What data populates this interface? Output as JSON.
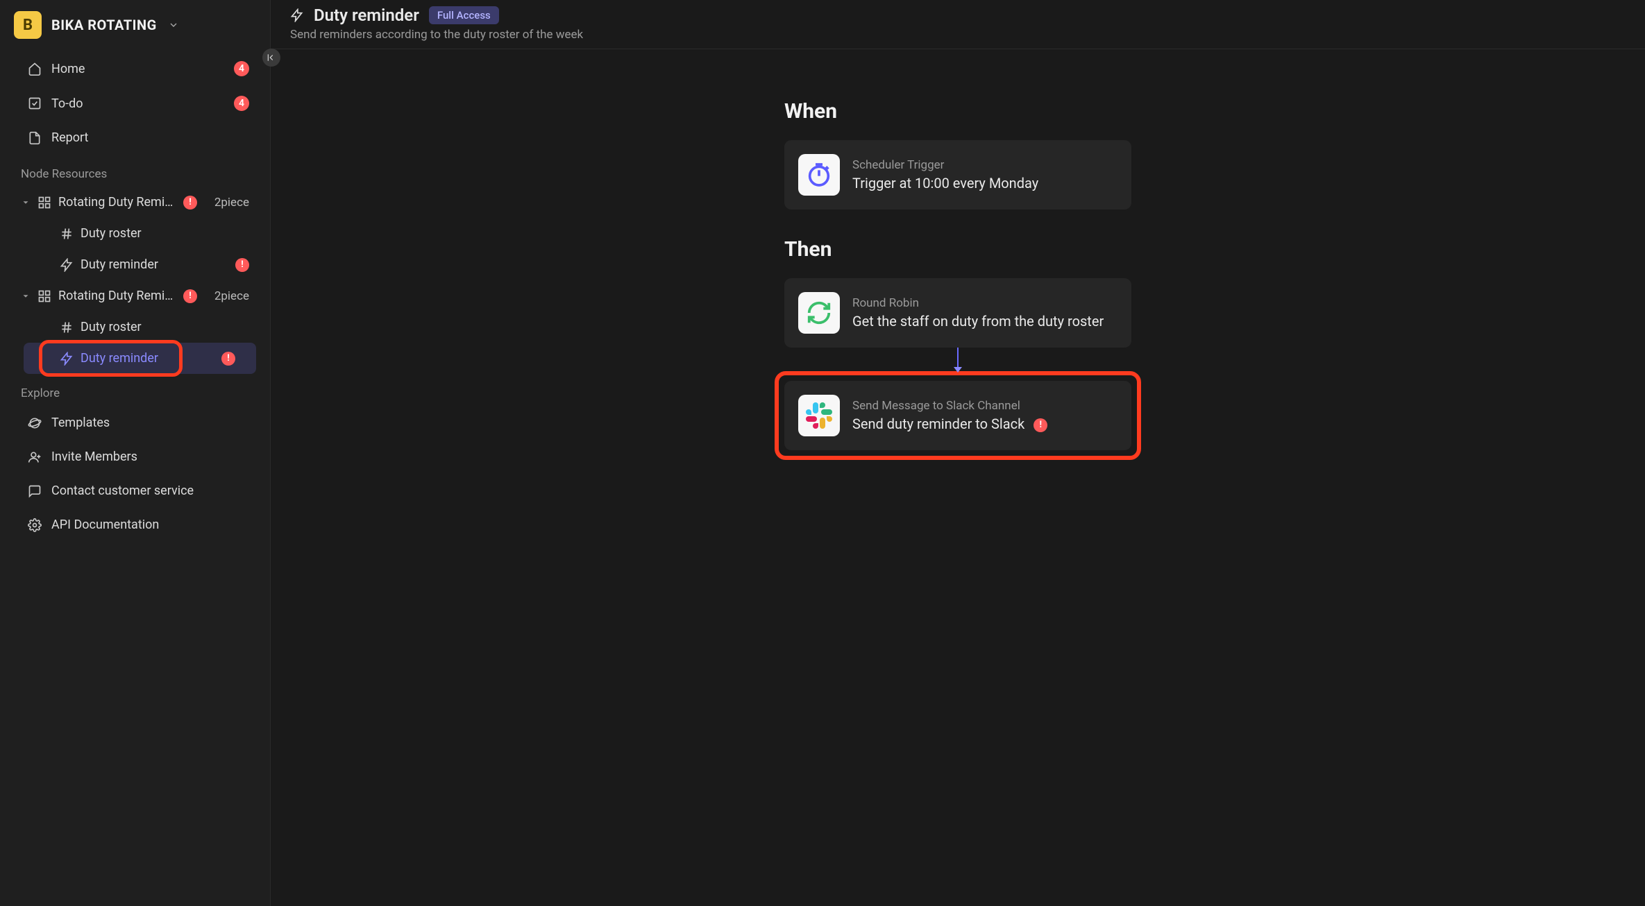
{
  "workspace": {
    "avatar_letter": "B",
    "name": "BIKA ROTATING"
  },
  "nav": {
    "home": {
      "label": "Home",
      "badge": "4"
    },
    "todo": {
      "label": "To-do",
      "badge": "4"
    },
    "report": {
      "label": "Report"
    }
  },
  "sections": {
    "resources_label": "Node Resources",
    "explore_label": "Explore"
  },
  "tree": {
    "group1": {
      "label": "Rotating Duty Remin…",
      "count": "2piece"
    },
    "group1_roster": {
      "label": "Duty roster"
    },
    "group1_reminder": {
      "label": "Duty reminder"
    },
    "group2": {
      "label": "Rotating Duty Remin…",
      "count": "2piece"
    },
    "group2_roster": {
      "label": "Duty roster"
    },
    "group2_reminder": {
      "label": "Duty reminder"
    }
  },
  "explore": {
    "templates": {
      "label": "Templates"
    },
    "invite": {
      "label": "Invite Members"
    },
    "support": {
      "label": "Contact customer service"
    },
    "api": {
      "label": "API Documentation"
    }
  },
  "header": {
    "title": "Duty reminder",
    "access": "Full Access",
    "subtitle": "Send reminders according to the duty roster of the week"
  },
  "flow": {
    "when_label": "When",
    "then_label": "Then",
    "trigger": {
      "type_label": "Scheduler Trigger",
      "desc": "Trigger at 10:00 every Monday"
    },
    "step1": {
      "type_label": "Round Robin",
      "desc": "Get the staff on duty from the duty roster"
    },
    "step2": {
      "type_label": "Send Message to Slack Channel",
      "desc": "Send duty reminder to Slack"
    }
  }
}
